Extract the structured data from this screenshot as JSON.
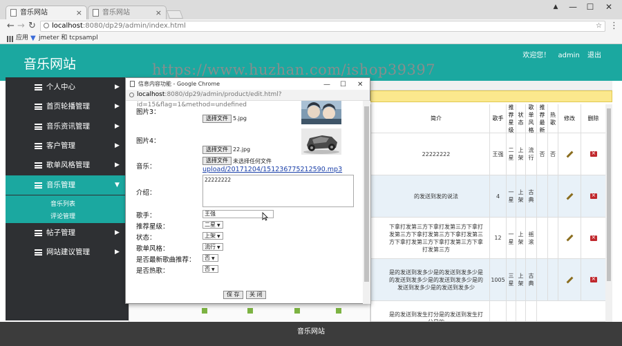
{
  "browser": {
    "tabs": [
      {
        "label": "音乐网站",
        "active": true
      },
      {
        "label": "音乐网站",
        "active": false
      }
    ],
    "address": {
      "host": "localhost",
      "path": ":8080/dp29/admin/index.html"
    },
    "bookmarks": {
      "apps": "应用",
      "jmeter": "jmeter 和 tcpsampl"
    },
    "window_controls": {
      "minimize": "—",
      "maximize": "☐",
      "close": "✕"
    }
  },
  "header": {
    "site_title": "音乐网站",
    "welcome": "欢迎您！",
    "user": "admin",
    "logout": "退出"
  },
  "watermark": "https://www.huzhan.com/ishop39397",
  "sidebar": {
    "items": [
      {
        "label": "个人中心"
      },
      {
        "label": "首页轮播管理"
      },
      {
        "label": "音乐资讯管理"
      },
      {
        "label": "客户管理"
      },
      {
        "label": "歌单风格管理"
      },
      {
        "label": "音乐管理"
      },
      {
        "label": "帖子管理"
      },
      {
        "label": "网站建议管理"
      }
    ],
    "submenu": [
      "音乐列表",
      "评论管理"
    ]
  },
  "table": {
    "headers": [
      "简介",
      "歌手",
      "推荐星级",
      "状态",
      "歌单风格",
      "推荐最新",
      "热歌",
      "修改",
      "删除"
    ],
    "rows": [
      {
        "intro": "22222222",
        "singer": "王强",
        "stars": "二星",
        "status": "上架",
        "style": "流行",
        "newest": "否",
        "hot": "否"
      },
      {
        "intro": "的发送到发的说法",
        "singer": "4",
        "stars": "一星",
        "status": "上架",
        "style": "古典",
        "newest": "",
        "hot": ""
      },
      {
        "intro": "下拿打发第三方下拿打发第三方下拿打发第三方下拿打发第三方下拿打发第三方下拿打发第三方下拿打发第三方下拿打发第三方",
        "singer": "12",
        "stars": "一星",
        "status": "上架",
        "style": "摇滚",
        "newest": "",
        "hot": ""
      },
      {
        "intro": "是的发送到发多少是的发送到发多少是的发送到发多少是的发送到发多少是的发送到发多少是的发送到发多少",
        "singer": "1005",
        "stars": "三星",
        "status": "上架",
        "style": "古典",
        "newest": "",
        "hot": ""
      },
      {
        "intro": "是的发送到发生打分是的发送到发生打分是的",
        "singer": "",
        "stars": "",
        "status": "",
        "style": "",
        "newest": "",
        "hot": ""
      }
    ]
  },
  "footer": "音乐网站",
  "popup": {
    "title": "信息内容功能 - Google Chrome",
    "url_host": "localhost",
    "url_path": ":8080/dp29/admin/product/edit.html?id=15&flag=1&method=undefined",
    "fields": {
      "img3_label": "图片3：",
      "img3_btn": "选择文件",
      "img3_file": "5.jpg",
      "img4_label": "图片4：",
      "img4_btn": "选择文件",
      "img4_file": "22.jpg",
      "music_label": "音乐：",
      "music_btn": "选择文件",
      "music_none": "未选择任何文件",
      "music_link": "upload/20171204/1512367752125​90.mp3",
      "intro_label": "介绍：",
      "intro_value": "22222222",
      "singer_label": "歌手：",
      "singer_value": "王强",
      "stars_label": "推荐星级：",
      "stars_value": "二星",
      "status_label": "状态：",
      "status_value": "上架",
      "style_label": "歌单风格：",
      "style_value": "流行",
      "newest_label": "是否最新歌曲推荐：",
      "newest_value": "否",
      "hot_label": "是否热歌：",
      "hot_value": "否",
      "save": "保 存",
      "close": "关 闭"
    }
  }
}
